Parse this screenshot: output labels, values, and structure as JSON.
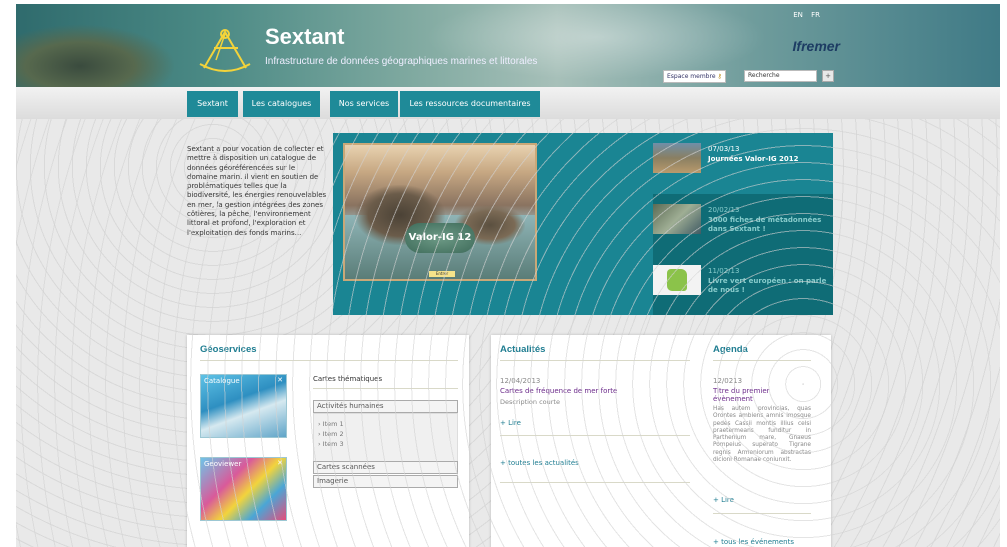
{
  "header": {
    "site_title": "Sextant",
    "site_subtitle": "Infrastructure de données géographiques marines et littorales",
    "lang_en": "EN",
    "lang_fr": "FR",
    "partner_logo": "Ifremer",
    "member_label": "Espace membre",
    "search_placeholder": "Recherche",
    "search_button": "+"
  },
  "nav": {
    "items": [
      {
        "label": "Sextant"
      },
      {
        "label": "Les catalogues"
      },
      {
        "label": "Nos services"
      },
      {
        "label": "Les ressources documentaires"
      }
    ]
  },
  "intro": "Sextant a pour vocation de collecter et mettre à disposition un catalogue de données géoréférencées sur le domaine marin. Il vient en soutien de problématiques telles que la biodiversité, les énergies renouvelables en mer, la gestion intégrées des zones côtières, la pêche, l'environnement littoral et profond, l'exploration et l'exploitation des fonds marins...",
  "slider": {
    "photo_label": "Valor-IG 12",
    "photo_button": "Entrer",
    "news": [
      {
        "date": "07/03/13",
        "title": "Journées Valor-IG 2012"
      },
      {
        "date": "20/02/13",
        "title": "3000 fiches de métadonnées dans Sextant !"
      },
      {
        "date": "11/02/13",
        "title": "Livre vert européen : on parle de nous !"
      }
    ]
  },
  "geoservices": {
    "title": "Géoservices",
    "card1": "Catalogue",
    "card2": "Geoviewer",
    "thematic_title": "Cartes thématiques",
    "accordion": [
      {
        "label": "Activités humaines"
      },
      {
        "label": "Cartes scannées"
      },
      {
        "label": "Imagerie"
      }
    ],
    "sub_items": [
      "Item 1",
      "Item 2",
      "Item 3"
    ]
  },
  "actualites": {
    "title": "Actualités",
    "date": "12/04/2013",
    "headline": "Cartes de fréquence de mer forte",
    "desc": "Description courte",
    "more": "+ Lire",
    "all": "+ toutes les actualités"
  },
  "agenda": {
    "title": "Agenda",
    "date": "12/0213",
    "headline": "Titre du premier évènement",
    "body": "Has autem provincias, quas Orontes ambiens amnis imosque pedes Cassii montis illius celsi praetermeans funditur in Parthenium mare, Gnaeus Pompeius superato Tigrane regnis Armeniorum abstractas dicioni Romanae coniunxit.",
    "more": "+ Lire",
    "all": "+ tous les événements"
  }
}
